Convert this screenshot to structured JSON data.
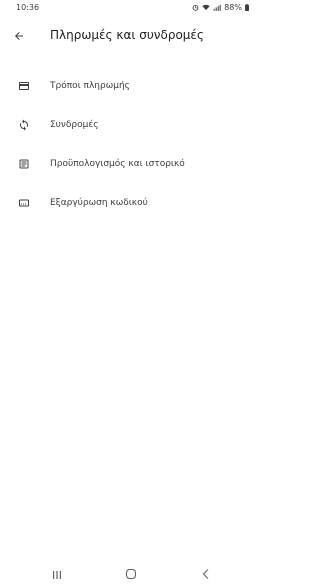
{
  "status_bar": {
    "time": "10:36",
    "battery": "88%"
  },
  "app_bar": {
    "title": "Πληρωμές και συνδρομές",
    "back_icon": "arrow-left-icon"
  },
  "menu": {
    "items": [
      {
        "label": "Τρόποι πληρωμής",
        "icon": "credit-card-icon"
      },
      {
        "label": "Συνδρομές",
        "icon": "sync-icon"
      },
      {
        "label": "Προϋπολογισμός και ιστορικό",
        "icon": "list-document-icon"
      },
      {
        "label": "Εξαργύρωση κωδικού",
        "icon": "code-card-icon"
      }
    ]
  },
  "nav_bar": {
    "recents_icon": "recents-icon",
    "home_icon": "home-icon",
    "back_icon": "back-chevron-icon"
  },
  "colors": {
    "text_primary": "#202124",
    "text_secondary": "#3c4043",
    "icon": "#3c4043",
    "background": "#ffffff"
  }
}
